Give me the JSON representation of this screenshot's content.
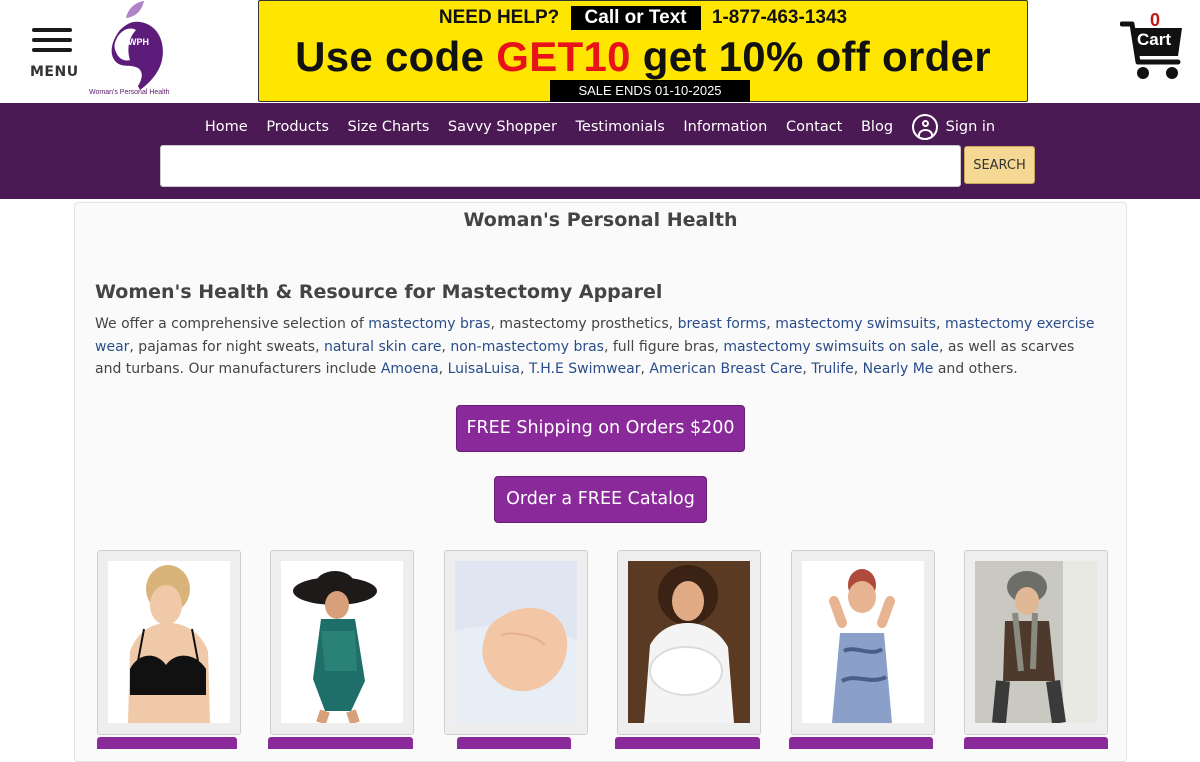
{
  "header": {
    "menu_label": "MENU",
    "logo_text": "Woman's Personal Health",
    "logo_monogram": "WPH",
    "promo": {
      "need_help": "NEED HELP?",
      "call_text": "Call or Text",
      "phone": "1-877-463-1343",
      "code_prefix": "Use code",
      "code": "GET10",
      "code_suffix": "get 10% off order",
      "sale_ends": "SALE ENDS 01-10-2025"
    },
    "cart": {
      "count": "0",
      "label": "Cart"
    }
  },
  "nav": {
    "items": [
      "Home",
      "Products",
      "Size Charts",
      "Savvy Shopper",
      "Testimonials",
      "Information",
      "Contact",
      "Blog"
    ],
    "signin": "Sign in",
    "search_placeholder": "",
    "search_button": "SEARCH"
  },
  "main": {
    "site_title": "Woman's Personal Health",
    "heading": "Women's Health & Resource for Mastectomy Apparel",
    "intro": {
      "t1": "We offer a comprehensive selection of ",
      "l1": "mastectomy bras",
      "t2": ", mastectomy prosthetics, ",
      "l2": "breast forms",
      "t3": ", ",
      "l3": "mastectomy swimsuits",
      "t4": ", ",
      "l4": "mastectomy exercise wear",
      "t5": ", pajamas for night sweats, ",
      "l5": "natural skin care",
      "t6": ", ",
      "l6": "non-mastectomy bras",
      "t7": ", full figure bras, ",
      "l7": "mastectomy swimsuits on sale",
      "t8": ", as well as scarves and turbans. Our manufacturers include ",
      "l8": "Amoena",
      "t9": ", ",
      "l9": "LuisaLuisa",
      "t10": ", ",
      "l10": "T.H.E Swimwear",
      "t11": ", ",
      "l11": "American Breast Care",
      "t12": ", ",
      "l12": "Trulife",
      "t13": ", ",
      "l13": "Nearly Me",
      "t14": " and others."
    },
    "cta_shipping": "FREE Shipping on Orders $200",
    "cta_catalog": "Order a FREE Catalog"
  },
  "colors": {
    "nav_bg": "#4b1a55",
    "promo_bg": "#ffe600",
    "accent_purple": "#8a2a9a",
    "promo_code_red": "#e8121b",
    "link_blue": "#2a4d8a"
  }
}
